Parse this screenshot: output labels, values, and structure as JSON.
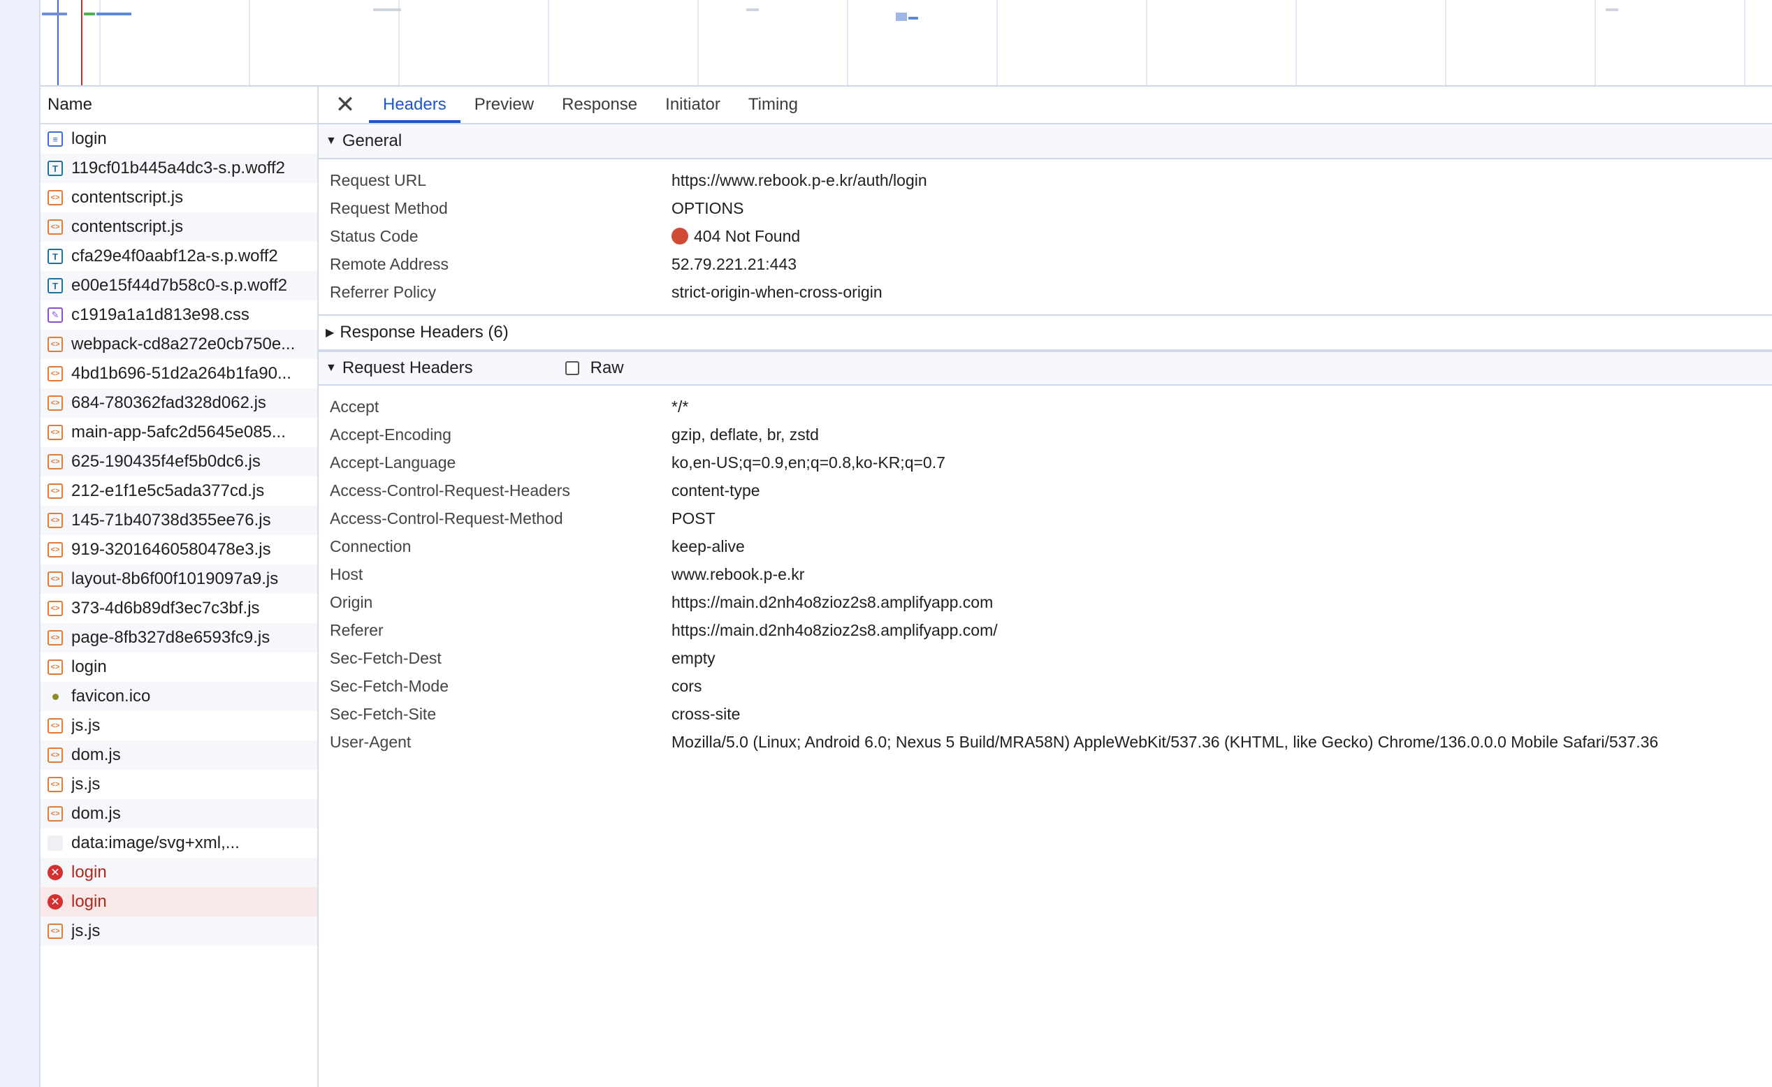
{
  "overview": {
    "colors": {
      "grid": "#dfe6f6",
      "blue_marker": "#3d6fd1",
      "red_marker": "#c62828"
    }
  },
  "name_panel": {
    "header": "Name",
    "rows": [
      {
        "label": "login",
        "icon": "document-icon",
        "glyph": "≡",
        "type": "doc",
        "error": false,
        "selected": false
      },
      {
        "label": "119cf01b445a4dc3-s.p.woff2",
        "icon": "font-file-icon",
        "glyph": "T",
        "type": "font",
        "error": false,
        "selected": false
      },
      {
        "label": "contentscript.js",
        "icon": "script-icon",
        "glyph": "<>",
        "type": "script",
        "error": false,
        "selected": false
      },
      {
        "label": "contentscript.js",
        "icon": "script-icon",
        "glyph": "<>",
        "type": "script",
        "error": false,
        "selected": false
      },
      {
        "label": "cfa29e4f0aabf12a-s.p.woff2",
        "icon": "font-file-icon",
        "glyph": "T",
        "type": "font",
        "error": false,
        "selected": false
      },
      {
        "label": "e00e15f44d7b58c0-s.p.woff2",
        "icon": "font-file-icon",
        "glyph": "T",
        "type": "font",
        "error": false,
        "selected": false
      },
      {
        "label": "c1919a1a1d813e98.css",
        "icon": "stylesheet-icon",
        "glyph": "✎",
        "type": "css",
        "error": false,
        "selected": false
      },
      {
        "label": "webpack-cd8a272e0cb750e...",
        "icon": "script-icon",
        "glyph": "<>",
        "type": "script",
        "error": false,
        "selected": false
      },
      {
        "label": "4bd1b696-51d2a264b1fa90...",
        "icon": "script-icon",
        "glyph": "<>",
        "type": "script",
        "error": false,
        "selected": false
      },
      {
        "label": "684-780362fad328d062.js",
        "icon": "script-icon",
        "glyph": "<>",
        "type": "script",
        "error": false,
        "selected": false
      },
      {
        "label": "main-app-5afc2d5645e085...",
        "icon": "script-icon",
        "glyph": "<>",
        "type": "script",
        "error": false,
        "selected": false
      },
      {
        "label": "625-190435f4ef5b0dc6.js",
        "icon": "script-icon",
        "glyph": "<>",
        "type": "script",
        "error": false,
        "selected": false
      },
      {
        "label": "212-e1f1e5c5ada377cd.js",
        "icon": "script-icon",
        "glyph": "<>",
        "type": "script",
        "error": false,
        "selected": false
      },
      {
        "label": "145-71b40738d355ee76.js",
        "icon": "script-icon",
        "glyph": "<>",
        "type": "script",
        "error": false,
        "selected": false
      },
      {
        "label": "919-32016460580478e3.js",
        "icon": "script-icon",
        "glyph": "<>",
        "type": "script",
        "error": false,
        "selected": false
      },
      {
        "label": "layout-8b6f00f1019097a9.js",
        "icon": "script-icon",
        "glyph": "<>",
        "type": "script",
        "error": false,
        "selected": false
      },
      {
        "label": "373-4d6b89df3ec7c3bf.js",
        "icon": "script-icon",
        "glyph": "<>",
        "type": "script",
        "error": false,
        "selected": false
      },
      {
        "label": "page-8fb327d8e6593fc9.js",
        "icon": "script-icon",
        "glyph": "<>",
        "type": "script",
        "error": false,
        "selected": false
      },
      {
        "label": "login",
        "icon": "script-icon",
        "glyph": "<>",
        "type": "script",
        "error": false,
        "selected": false
      },
      {
        "label": "favicon.ico",
        "icon": "image-icon",
        "glyph": "",
        "type": "fav",
        "error": false,
        "selected": false
      },
      {
        "label": "js.js",
        "icon": "script-icon",
        "glyph": "<>",
        "type": "script",
        "error": false,
        "selected": false
      },
      {
        "label": "dom.js",
        "icon": "script-icon",
        "glyph": "<>",
        "type": "script",
        "error": false,
        "selected": false
      },
      {
        "label": "js.js",
        "icon": "script-icon",
        "glyph": "<>",
        "type": "script",
        "error": false,
        "selected": false
      },
      {
        "label": "dom.js",
        "icon": "script-icon",
        "glyph": "<>",
        "type": "script",
        "error": false,
        "selected": false
      },
      {
        "label": "data:image/svg+xml,...",
        "icon": "image-icon",
        "glyph": "",
        "type": "blank",
        "error": false,
        "selected": false
      },
      {
        "label": "login",
        "icon": "error-icon",
        "glyph": "✕",
        "type": "err",
        "error": true,
        "selected": false
      },
      {
        "label": "login",
        "icon": "error-icon",
        "glyph": "✕",
        "type": "err",
        "error": true,
        "selected": true
      },
      {
        "label": "js.js",
        "icon": "script-icon",
        "glyph": "<>",
        "type": "script",
        "error": false,
        "selected": false
      }
    ]
  },
  "detail": {
    "close_glyph": "✕",
    "tabs": [
      {
        "label": "Headers",
        "active": true
      },
      {
        "label": "Preview",
        "active": false
      },
      {
        "label": "Response",
        "active": false
      },
      {
        "label": "Initiator",
        "active": false
      },
      {
        "label": "Timing",
        "active": false
      }
    ],
    "general": {
      "title": "General",
      "expanded_glyph": "▼",
      "rows": [
        {
          "key": "Request URL",
          "value": "https://www.rebook.p-e.kr/auth/login"
        },
        {
          "key": "Request Method",
          "value": "OPTIONS"
        },
        {
          "key": "Status Code",
          "value": "404 Not Found",
          "status_color": "#d04a35"
        },
        {
          "key": "Remote Address",
          "value": "52.79.221.21:443"
        },
        {
          "key": "Referrer Policy",
          "value": "strict-origin-when-cross-origin"
        }
      ]
    },
    "response_headers": {
      "title": "Response Headers (6)",
      "collapsed_glyph": "▶"
    },
    "request_headers": {
      "title": "Request Headers",
      "expanded_glyph": "▼",
      "raw_label": "Raw",
      "raw_checked": false,
      "rows": [
        {
          "key": "Accept",
          "value": "*/*"
        },
        {
          "key": "Accept-Encoding",
          "value": "gzip, deflate, br, zstd"
        },
        {
          "key": "Accept-Language",
          "value": "ko,en-US;q=0.9,en;q=0.8,ko-KR;q=0.7"
        },
        {
          "key": "Access-Control-Request-Headers",
          "value": "content-type"
        },
        {
          "key": "Access-Control-Request-Method",
          "value": "POST"
        },
        {
          "key": "Connection",
          "value": "keep-alive"
        },
        {
          "key": "Host",
          "value": "www.rebook.p-e.kr"
        },
        {
          "key": "Origin",
          "value": "https://main.d2nh4o8zioz2s8.amplifyapp.com"
        },
        {
          "key": "Referer",
          "value": "https://main.d2nh4o8zioz2s8.amplifyapp.com/"
        },
        {
          "key": "Sec-Fetch-Dest",
          "value": "empty"
        },
        {
          "key": "Sec-Fetch-Mode",
          "value": "cors"
        },
        {
          "key": "Sec-Fetch-Site",
          "value": "cross-site"
        },
        {
          "key": "User-Agent",
          "value": "Mozilla/5.0 (Linux; Android 6.0; Nexus 5 Build/MRA58N) AppleWebKit/537.36 (KHTML, like Gecko) Chrome/136.0.0.0 Mobile Safari/537.36"
        }
      ]
    }
  }
}
